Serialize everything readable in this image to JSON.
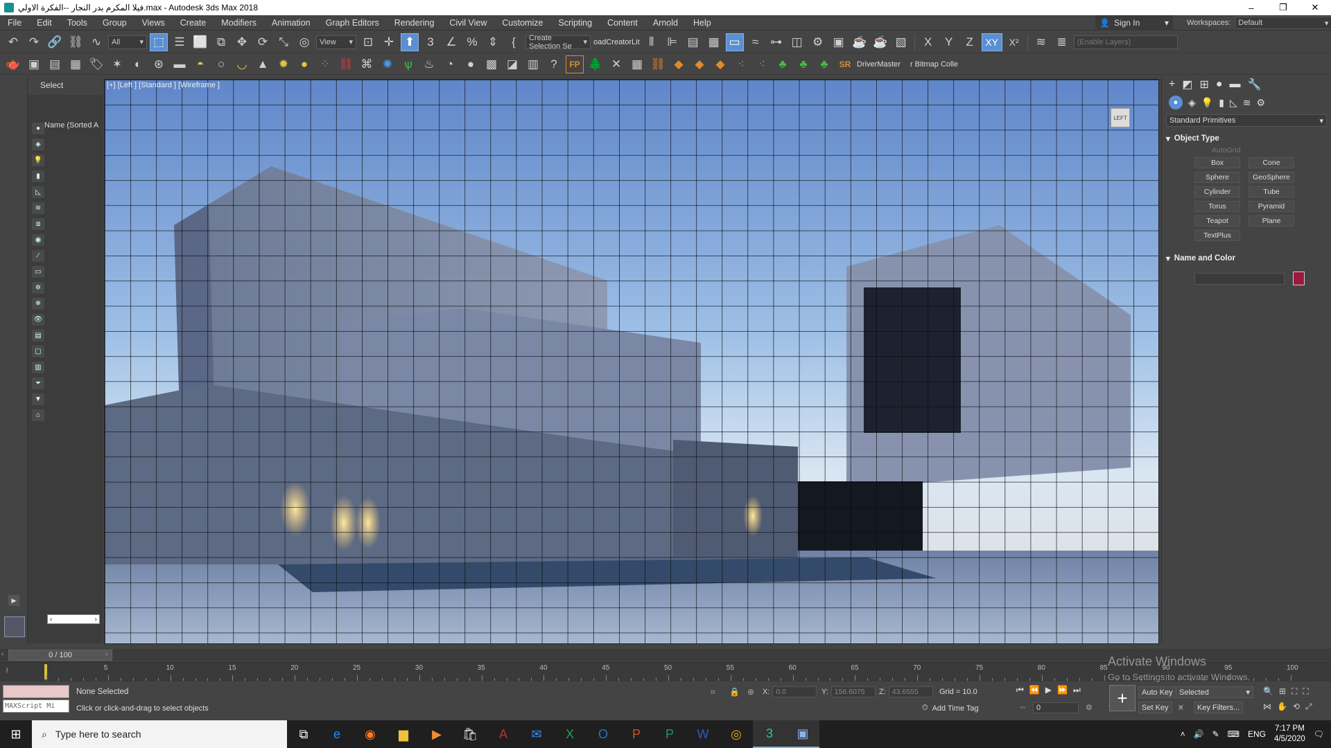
{
  "window": {
    "title": "فيلا المكرم بدر النجار --الفكرة الاولي.max - Autodesk 3ds Max 2018",
    "minimize": "–",
    "restore": "❐",
    "close": "✕"
  },
  "menu": [
    "File",
    "Edit",
    "Tools",
    "Group",
    "Views",
    "Create",
    "Modifiers",
    "Animation",
    "Graph Editors",
    "Rendering",
    "Civil View",
    "Customize",
    "Scripting",
    "Content",
    "Arnold",
    "Help"
  ],
  "signin": {
    "label": "Sign In"
  },
  "workspace": {
    "label": "Workspaces:",
    "value": "Default"
  },
  "toolbar1": {
    "filter_value": "All",
    "refcoord_value": "View",
    "named_sel": "Create Selection Se",
    "plugin_text": "oadCreatorLit",
    "axis_x": "X",
    "axis_y": "Y",
    "axis_z": "Z",
    "axis_xy": "XY",
    "axis_xr": "X²",
    "layers_placeholder": "(Enable Layers)"
  },
  "toolbar2": {
    "fp_label": "FP",
    "sr_label": "SR",
    "drivermaster": "DriverMaster",
    "bitmap": "r Bitmap Colle"
  },
  "scene_explorer": {
    "header": "Select",
    "column": "Name (Sorted A"
  },
  "viewport": {
    "label": "[+] [Left ] [Standard ] [Wireframe ]",
    "viewcube": "LEFT"
  },
  "command_panel": {
    "category": "Standard Primitives",
    "object_type": "Object Type",
    "autogrid": "AutoGrid",
    "buttons": [
      "Box",
      "Cone",
      "Sphere",
      "GeoSphere",
      "Cylinder",
      "Tube",
      "Torus",
      "Pyramid",
      "Teapot",
      "Plane",
      "TextPlus"
    ],
    "name_color": "Name and Color",
    "swatch_color": "#9c1a3c"
  },
  "timeline": {
    "slider": "0 / 100",
    "ticks": [
      5,
      10,
      15,
      20,
      25,
      30,
      35,
      40,
      45,
      50,
      55,
      60,
      65,
      70,
      75,
      80,
      85,
      90,
      95,
      100
    ]
  },
  "status": {
    "maxscript": "MAXScript Mi",
    "selection": "None Selected",
    "prompt": "Click or click-and-drag to select objects",
    "x_label": "X:",
    "x_value": "0.0",
    "y_label": "Y:",
    "y_value": "156.6075",
    "z_label": "Z:",
    "z_value": "43.6555",
    "grid": "Grid = 10.0",
    "add_time_tag": "Add Time Tag",
    "frame": "0",
    "auto_key": "Auto Key",
    "set_key": "Set Key",
    "selected": "Selected",
    "key_filters": "Key Filters..."
  },
  "watermark": {
    "line1": "Activate Windows",
    "line2": "Go to Settings to activate Windows."
  },
  "taskbar": {
    "search_placeholder": "Type here to search",
    "lang": "ENG",
    "time": "7:17 PM",
    "date": "4/5/2020"
  }
}
